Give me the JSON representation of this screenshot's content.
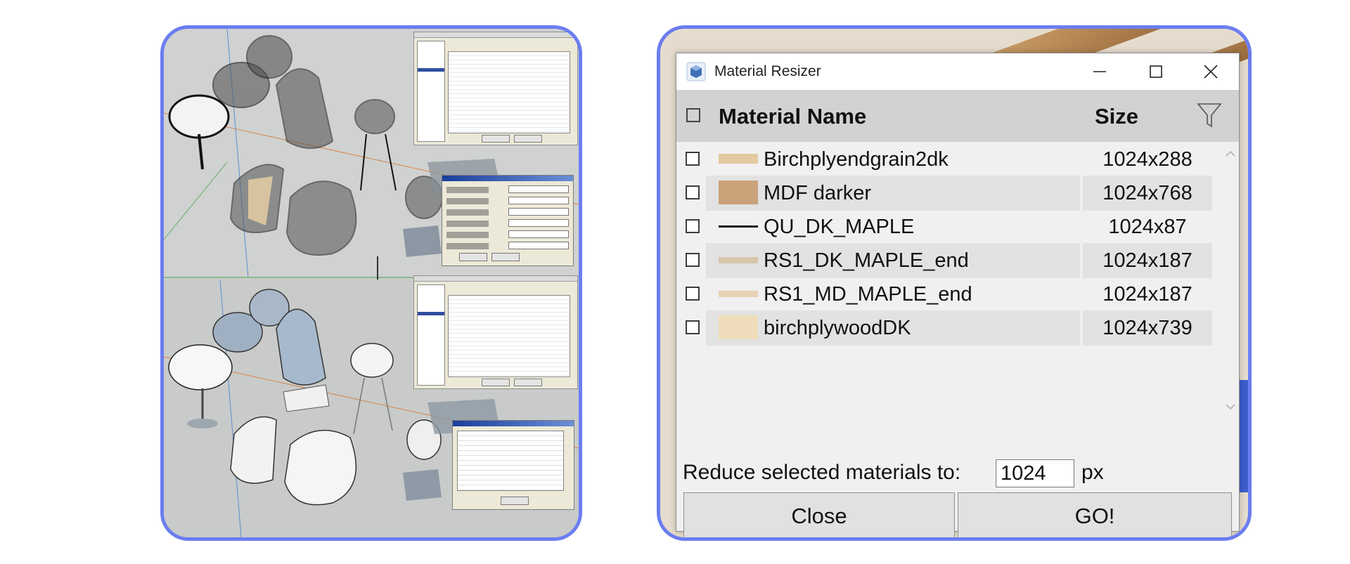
{
  "window": {
    "title": "Material Resizer",
    "controls": {
      "minimize": "minimize",
      "maximize": "maximize",
      "close": "close"
    }
  },
  "table": {
    "columns": {
      "name": "Material Name",
      "size": "Size"
    },
    "rows": [
      {
        "name": "Birchplyendgrain2dk",
        "size": "1024x288",
        "swatch": "#e3c9a0",
        "checked": false
      },
      {
        "name": "MDF darker",
        "size": "1024x768",
        "swatch": "#c9a27a",
        "checked": false
      },
      {
        "name": "QU_DK_MAPLE",
        "size": "1024x87",
        "swatch": "#111111",
        "checked": false
      },
      {
        "name": "RS1_DK_MAPLE_end",
        "size": "1024x187",
        "swatch": "#d8c5aa",
        "checked": false
      },
      {
        "name": "RS1_MD_MAPLE_end",
        "size": "1024x187",
        "swatch": "#e7d3b4",
        "checked": false
      },
      {
        "name": "birchplywoodDK",
        "size": "1024x739",
        "swatch": "#efdcba",
        "checked": false
      }
    ]
  },
  "footer": {
    "reduce_label": "Reduce selected materials to:",
    "px_value": "1024",
    "px_unit": "px",
    "close_label": "Close",
    "go_label": "GO!"
  },
  "colors": {
    "panel_border": "#6b7df0",
    "header_bg": "#d2d2d2",
    "alt_row": "#e2e2e2"
  }
}
